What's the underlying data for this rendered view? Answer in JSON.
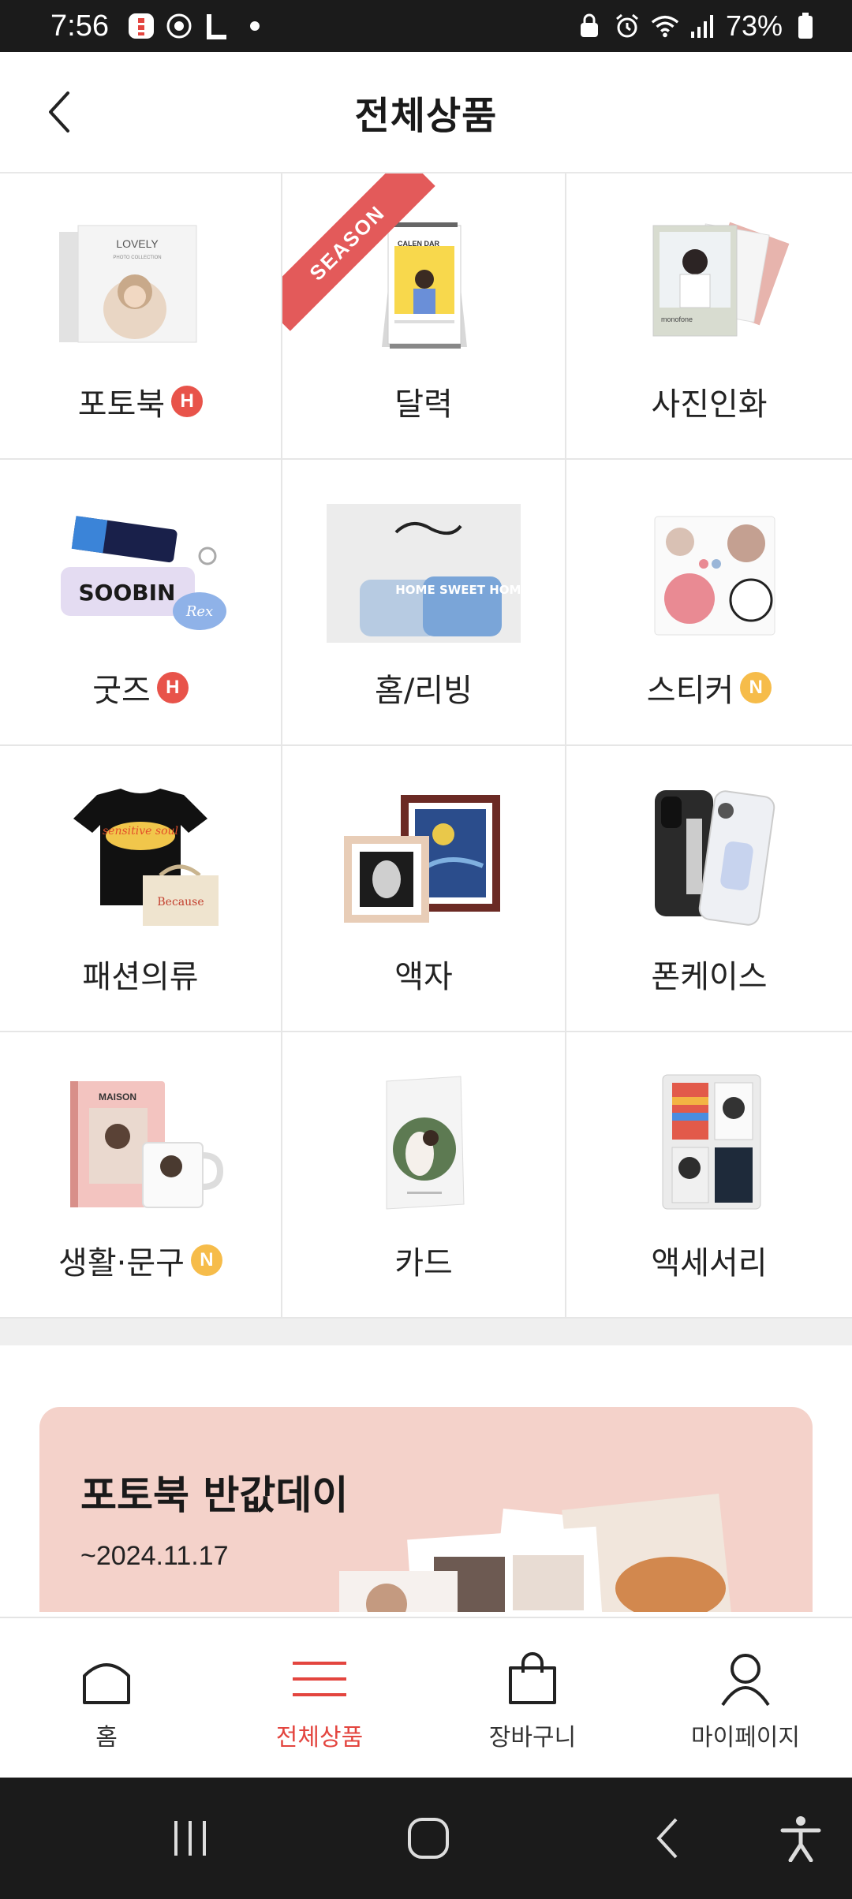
{
  "status_bar": {
    "time": "7:56",
    "battery_text": "73%",
    "icons_left": [
      "notification-app-icon",
      "target-app-icon",
      "l-app-icon",
      "dot-icon"
    ],
    "icons_right": [
      "lock-icon",
      "alarm-icon",
      "wifi-icon",
      "signal-icon",
      "battery-icon"
    ]
  },
  "header": {
    "title": "전체상품",
    "back_icon": "chevron-left-icon"
  },
  "categories": [
    {
      "label": "포토북",
      "badge": "H"
    },
    {
      "label": "달력",
      "badge": "",
      "ribbon": "SEASON"
    },
    {
      "label": "사진인화",
      "badge": ""
    },
    {
      "label": "굿즈",
      "badge": "H"
    },
    {
      "label": "홈/리빙",
      "badge": ""
    },
    {
      "label": "스티커",
      "badge": "N"
    },
    {
      "label": "패션의류",
      "badge": ""
    },
    {
      "label": "액자",
      "badge": ""
    },
    {
      "label": "폰케이스",
      "badge": ""
    },
    {
      "label": "생활·문구",
      "badge": "N"
    },
    {
      "label": "카드",
      "badge": ""
    },
    {
      "label": "액세서리",
      "badge": ""
    }
  ],
  "product_image_text": {
    "photobook_cover": "LOVELY",
    "photobook_sub": "PHOTO COLLECTION",
    "calendar_text": "CALEN DAR",
    "goods_tag": "SOOBIN",
    "goods_charm": "Rex",
    "pillow_text": "HOME SWEET HOME",
    "tshirt_text": "sensitive soul",
    "bag_text": "Because",
    "notebook_text": "MAISON",
    "print_brand": "monofone"
  },
  "banner": {
    "title": "포토북 반값데이",
    "date": "~2024.11.17",
    "background": "#f4d2ca"
  },
  "bottom_nav": [
    {
      "label": "홈",
      "icon": "home-icon",
      "active": false
    },
    {
      "label": "전체상품",
      "icon": "menu-icon",
      "active": true
    },
    {
      "label": "장바구니",
      "icon": "shopping-bag-icon",
      "active": false
    },
    {
      "label": "마이페이지",
      "icon": "user-icon",
      "active": false
    }
  ],
  "system_nav": [
    "recent-apps-icon",
    "home-button-icon",
    "back-icon",
    "accessibility-icon"
  ],
  "colors": {
    "accent": "#e3453f",
    "badge_h": "#e8534a",
    "badge_n": "#f6bc4a",
    "ribbon": "#e35a5a"
  }
}
